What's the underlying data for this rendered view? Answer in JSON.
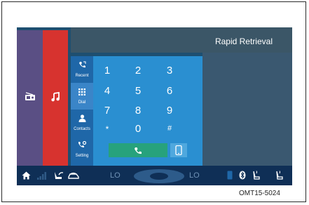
{
  "screen": {
    "title": "Rapid Retrieval"
  },
  "side_menu": {
    "items": [
      {
        "label": "Recent"
      },
      {
        "label": "Dial"
      },
      {
        "label": "Contacts"
      },
      {
        "label": "Setting"
      }
    ]
  },
  "keypad": {
    "keys": [
      "1",
      "2",
      "3",
      "4",
      "5",
      "6",
      "7",
      "8",
      "9",
      "*",
      "0",
      "#"
    ]
  },
  "climate": {
    "left_temp": "LO",
    "right_temp": "LO"
  },
  "caption": "OMT15-5024",
  "colors": {
    "radio_tab": "#5a4f84",
    "music_tab": "#d7332f",
    "keypad_bg": "#2a8fd1",
    "call_button": "#27a27c"
  },
  "icons": {
    "tabs": [
      "radio-icon",
      "music-note-icon"
    ],
    "menu": [
      "recent-calls-icon",
      "dial-pad-icon",
      "contacts-icon",
      "settings-icon"
    ],
    "bottom": [
      "home-icon",
      "signal-icon",
      "seat-icon",
      "car-icon",
      "fan-icon",
      "phone-icon",
      "bluetooth-icon",
      "seat-heat-left-icon",
      "seat-heat-right-icon"
    ]
  }
}
